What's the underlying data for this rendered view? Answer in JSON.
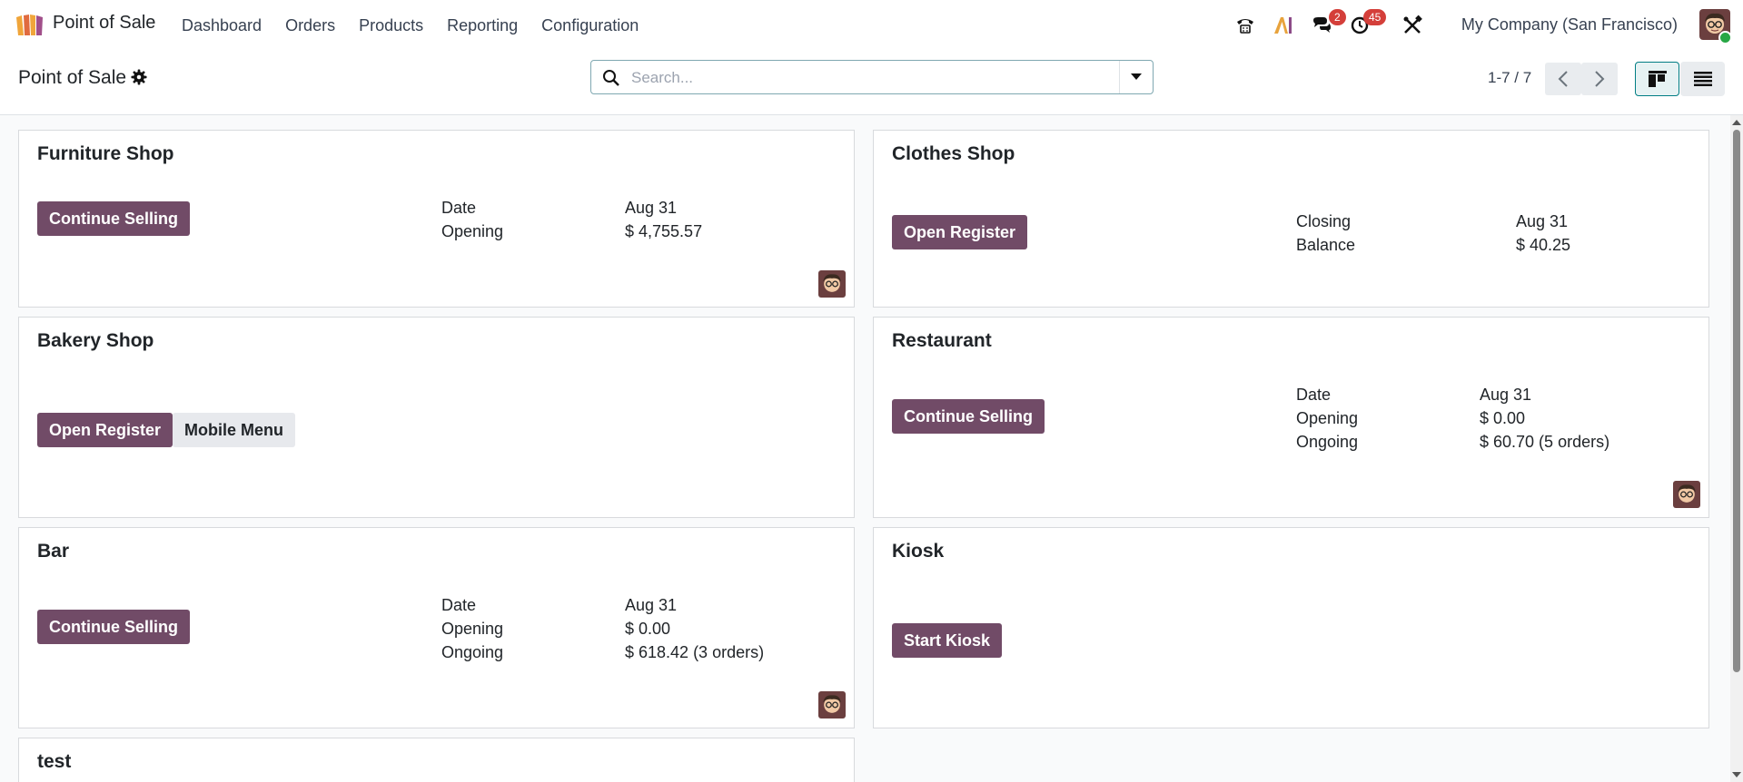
{
  "app": {
    "name": "Point of Sale",
    "menu": [
      "Dashboard",
      "Orders",
      "Products",
      "Reporting",
      "Configuration"
    ]
  },
  "systray": {
    "messages_count": "2",
    "activities_count": "45",
    "company": "My Company (San Francisco)"
  },
  "control_panel": {
    "title": "Point of Sale",
    "search_placeholder": "Search...",
    "pager": "1-7 / 7"
  },
  "colors": {
    "brand": "#714b67",
    "accent": "#017e84",
    "badge": "#d43f3a"
  },
  "cards": {
    "furniture": {
      "title": "Furniture Shop",
      "button": "Continue Selling",
      "labels": [
        "Date",
        "Opening"
      ],
      "values": [
        "Aug 31",
        "$ 4,755.57"
      ]
    },
    "clothes": {
      "title": "Clothes Shop",
      "button": "Open Register",
      "labels": [
        "Closing",
        "Balance"
      ],
      "values": [
        "Aug 31",
        "$ 40.25"
      ]
    },
    "bakery": {
      "title": "Bakery Shop",
      "button": "Open Register",
      "button2": "Mobile Menu"
    },
    "restaurant": {
      "title": "Restaurant",
      "button": "Continue Selling",
      "labels": [
        "Date",
        "Opening",
        "Ongoing"
      ],
      "values": [
        "Aug 31",
        "$ 0.00",
        "$ 60.70 (5 orders)"
      ]
    },
    "bar": {
      "title": "Bar",
      "button": "Continue Selling",
      "labels": [
        "Date",
        "Opening",
        "Ongoing"
      ],
      "values": [
        "Aug 31",
        "$ 0.00",
        "$ 618.42 (3 orders)"
      ]
    },
    "kiosk": {
      "title": "Kiosk",
      "button": "Start Kiosk"
    },
    "test": {
      "title": "test"
    }
  }
}
